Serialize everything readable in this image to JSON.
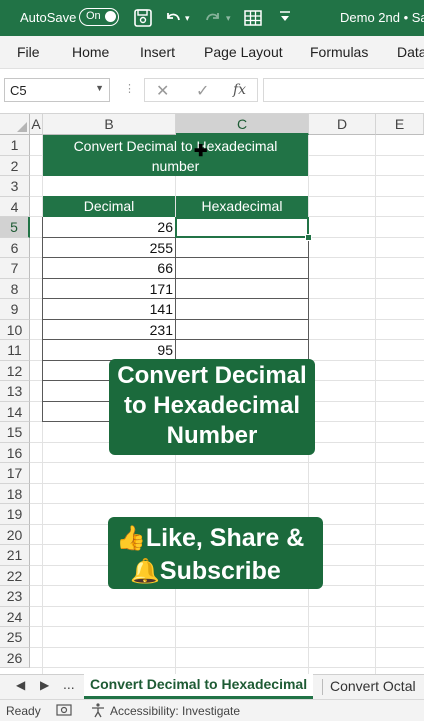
{
  "titlebar": {
    "autosave_label": "AutoSave",
    "toggle_state": "On",
    "doc_title": "Demo 2nd • Sa",
    "accent_color": "#217346",
    "icons": [
      "save-icon",
      "undo-icon",
      "redo-icon",
      "table-icon",
      "customize-icon"
    ]
  },
  "ribbon": {
    "tabs": [
      "File",
      "Home",
      "Insert",
      "Page Layout",
      "Formulas",
      "Data"
    ]
  },
  "formula_bar": {
    "name_box": "C5",
    "cancel_symbol": "✕",
    "enter_symbol": "✓",
    "fx_label": "fx",
    "formula": ""
  },
  "grid": {
    "columns": [
      "A",
      "B",
      "C",
      "D",
      "E"
    ],
    "selected_column": "C",
    "rows": [
      "1",
      "2",
      "3",
      "4",
      "5",
      "6",
      "7",
      "8",
      "9",
      "10",
      "11",
      "12",
      "13",
      "14",
      "15",
      "16",
      "17",
      "18",
      "19",
      "20",
      "21",
      "22",
      "23",
      "24",
      "25",
      "26"
    ],
    "selected_row": "5",
    "title_line1": "Convert Decimal to Hexadecimal",
    "title_line2": "number",
    "header_decimal": "Decimal",
    "header_hex": "Hexadecimal",
    "decimals": [
      "26",
      "255",
      "66",
      "171",
      "141",
      "231",
      "95"
    ]
  },
  "overlays": {
    "promo_line1": "Convert Decimal",
    "promo_line2": "to Hexadecimal",
    "promo_line3": "Number",
    "cta_line1": "Like, Share &",
    "cta_line2": "Subscribe",
    "cta_icons": [
      "thumbs-up-icon",
      "bell-icon"
    ]
  },
  "sheets": {
    "active": "Convert Decimal to Hexadecimal",
    "next": "Convert Octal",
    "more": "..."
  },
  "status": {
    "ready": "Ready",
    "accessibility": "Accessibility: Investigate"
  }
}
